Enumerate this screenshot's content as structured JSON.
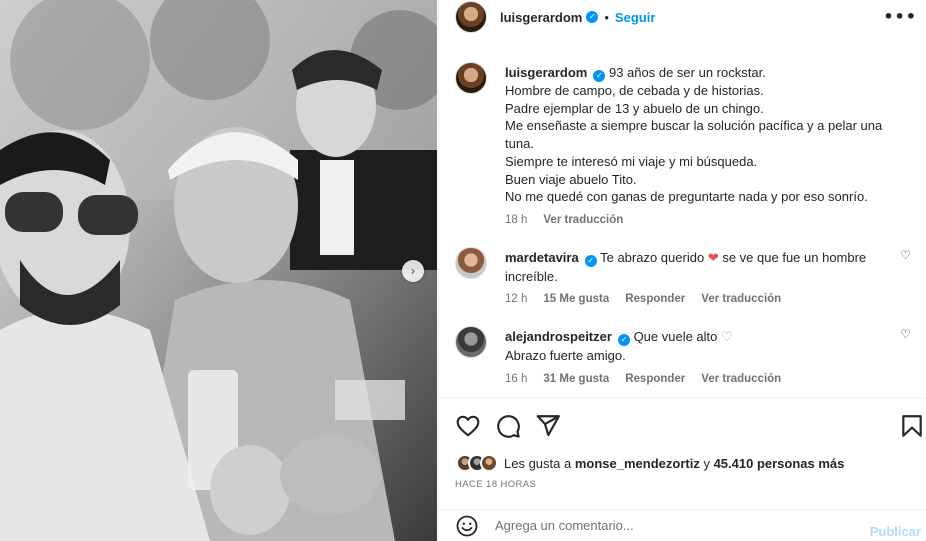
{
  "post": {
    "author": "luisgerardom",
    "follow_label": "Seguir",
    "dot": "•",
    "more_label": "•••",
    "carousel_next": "›"
  },
  "caption": {
    "username": "luisgerardom",
    "lines": [
      "93 años de ser un rockstar.",
      "Hombre de campo, de cebada y de historias.",
      "Padre ejemplar de 13 y abuelo de un chingo.",
      "Me enseñaste a siempre buscar la solución pacífica y a pelar una tuna.",
      "Siempre te interesó mi viaje y mi búsqueda.",
      "Buen viaje abuelo Tito.",
      "No me quedé con ganas de preguntarte nada y por eso sonrío."
    ],
    "time": "18 h",
    "translate": "Ver traducción"
  },
  "comments": [
    {
      "username": "mardetavira",
      "text_a": "Te abrazo querido",
      "heart": "❤",
      "text_b": "se ve que fue un hombre increíble.",
      "time": "12 h",
      "likes": "15 Me gusta",
      "reply": "Responder",
      "translate": "Ver traducción"
    },
    {
      "username": "alejandrospeitzer",
      "text_a": "Que vuele alto",
      "heart": "♡",
      "text_b": "Abrazo fuerte amigo.",
      "time": "16 h",
      "likes": "31 Me gusta",
      "reply": "Responder",
      "translate": "Ver traducción"
    }
  ],
  "likes": {
    "prefix": "Les gusta a",
    "user": "monse_mendezortiz",
    "connector": "y",
    "count": "45.410 personas más"
  },
  "time_ago": "HACE 18 HORAS",
  "add_comment": {
    "placeholder": "Agrega un comentario...",
    "publish": "Publicar"
  },
  "icons": {
    "verified": "✓",
    "comment_like": "♡"
  },
  "colors": {
    "accent": "#0095f6",
    "like_red": "#ed4956",
    "publish_disabled": "#b3dbff"
  }
}
